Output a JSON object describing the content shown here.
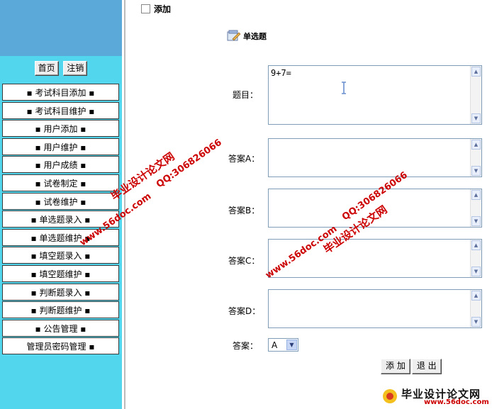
{
  "nav": {
    "home_label": "首页",
    "logout_label": "注销",
    "items": [
      "▪ 考试科目添加 ▪",
      "▪ 考试科目维护 ▪",
      "▪ 用户添加 ▪",
      "▪ 用户维护 ▪",
      "▪ 用户成绩 ▪",
      "▪ 试卷制定 ▪",
      "▪ 试卷维护 ▪",
      "▪ 单选题录入 ▪",
      "▪ 单选题维护 ▪",
      "▪ 填空题录入 ▪",
      "▪ 填空题维护 ▪",
      "▪ 判断题录入 ▪",
      "▪ 判断题维护 ▪",
      "▪ 公告管理 ▪",
      "管理员密码管理 ▪"
    ]
  },
  "header": {
    "title": "添加"
  },
  "section": {
    "title": "单选题"
  },
  "form": {
    "question_label": "题目：",
    "question_value": "9+7=",
    "answer_a_label": "答案A：",
    "answer_b_label": "答案B：",
    "answer_c_label": "答案C：",
    "answer_d_label": "答案D：",
    "answer_label": "答案：",
    "answer_selected": "A",
    "add_label": "添  加",
    "exit_label": "退  出"
  },
  "watermark": {
    "site_name": "毕业设计论文网",
    "url": "www.56doc.com",
    "qq": "QQ:306826066"
  },
  "footer": {
    "brand": "毕业设计论文网",
    "url": "www.56doc.com"
  }
}
